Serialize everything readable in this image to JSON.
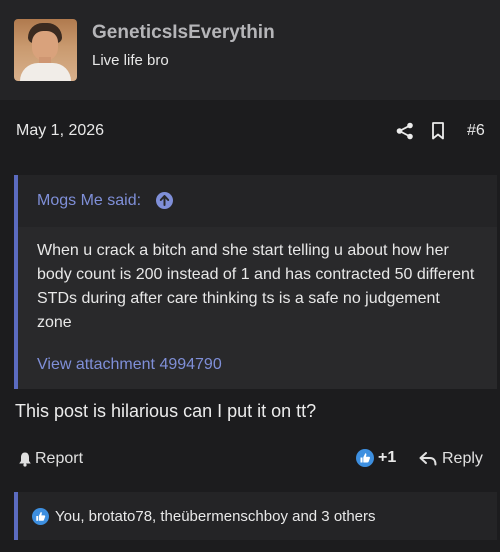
{
  "author": {
    "username": "GeneticsIsEverythin",
    "user_title": "Live life bro"
  },
  "meta": {
    "date": "May 1, 2026",
    "post_number": "#6",
    "icons": [
      "share-icon",
      "bookmark-icon"
    ]
  },
  "quote": {
    "author_label": "Mogs Me said:",
    "text": "When u crack a bitch and she start telling u about how her body count is 200 instead of 1 and has contracted 50 different STDs during after care thinking ts is a safe no judgement zone",
    "attachment_label": "View attachment 4994790",
    "accent_color": "#5b6bc0",
    "link_color": "#7f8fd8"
  },
  "body": {
    "text": "This post is hilarious can I put it on tt?"
  },
  "actions": {
    "report_label": "Report",
    "reaction_count": "+1",
    "reply_label": "Reply"
  },
  "reactions": {
    "summary": "You, brotato78, theübermenschboy and 3 others",
    "like_color": "#3d8fe0"
  }
}
